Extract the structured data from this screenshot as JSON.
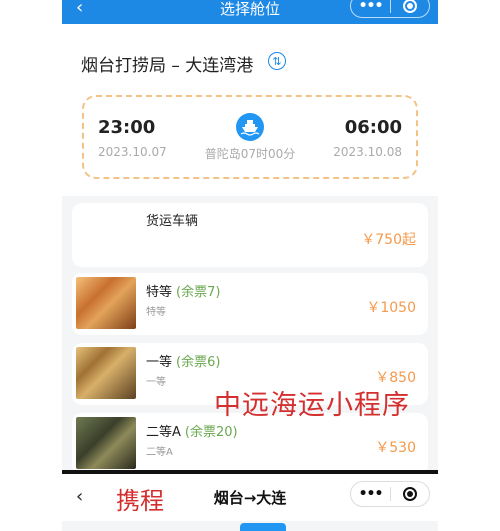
{
  "screen1": {
    "header": {
      "back_icon": "‹",
      "title": "选择舱位",
      "menu_icon": "•••"
    },
    "route": {
      "title": "烟台打捞局 – 大连湾港",
      "tag_icon": "transfer-icon"
    },
    "schedule": {
      "depart_time": "23:00",
      "depart_date": "2023.10.07",
      "arrive_time": "06:00",
      "arrive_date": "2023.10.08",
      "duration": "普陀岛07时00分"
    },
    "cabins": [
      {
        "name": "货运车辆",
        "remaining": "",
        "subtitle": "",
        "price": "￥750起"
      },
      {
        "name": "特等",
        "remaining": "(余票7)",
        "subtitle": "特等",
        "price": "￥1050"
      },
      {
        "name": "一等",
        "remaining": "(余票6)",
        "subtitle": "一等",
        "price": "￥850"
      },
      {
        "name": "二等A",
        "remaining": "(余票20)",
        "subtitle": "二等A",
        "price": "￥530"
      }
    ],
    "watermark": "中远海运小程序"
  },
  "screen2": {
    "back_icon": "‹",
    "title": "烟台→大连",
    "menu_icon": "•••",
    "watermark": "携程"
  },
  "colors": {
    "accent": "#1e88e5",
    "price": "#f59a4b",
    "remaining": "#6aa84f",
    "watermark": "#d32f2f",
    "dashed_border": "#f3c285"
  }
}
